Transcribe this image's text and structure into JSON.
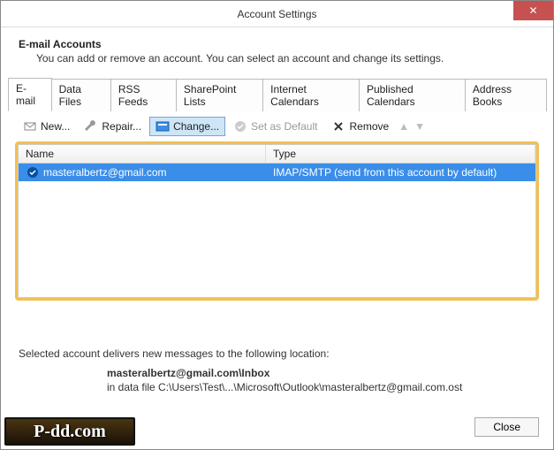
{
  "window": {
    "title": "Account Settings",
    "close_glyph": "✕"
  },
  "header": {
    "title": "E-mail Accounts",
    "subtitle": "You can add or remove an account. You can select an account and change its settings."
  },
  "tabs": [
    {
      "label": "E-mail",
      "active": true
    },
    {
      "label": "Data Files"
    },
    {
      "label": "RSS Feeds"
    },
    {
      "label": "SharePoint Lists"
    },
    {
      "label": "Internet Calendars"
    },
    {
      "label": "Published Calendars"
    },
    {
      "label": "Address Books"
    }
  ],
  "toolbar": {
    "new_label": "New...",
    "repair_label": "Repair...",
    "change_label": "Change...",
    "set_default_label": "Set as Default",
    "remove_label": "Remove"
  },
  "list": {
    "columns": {
      "name": "Name",
      "type": "Type"
    },
    "rows": [
      {
        "name": "masteralbertz@gmail.com",
        "type": "IMAP/SMTP (send from this account by default)"
      }
    ]
  },
  "footer": {
    "intro": "Selected account delivers new messages to the following location:",
    "loc_bold": "masteralbertz@gmail.com\\Inbox",
    "loc_path": "in data file C:\\Users\\Test\\...\\Microsoft\\Outlook\\masteralbertz@gmail.com.ost"
  },
  "close_label": "Close",
  "watermark": "P-dd.com"
}
